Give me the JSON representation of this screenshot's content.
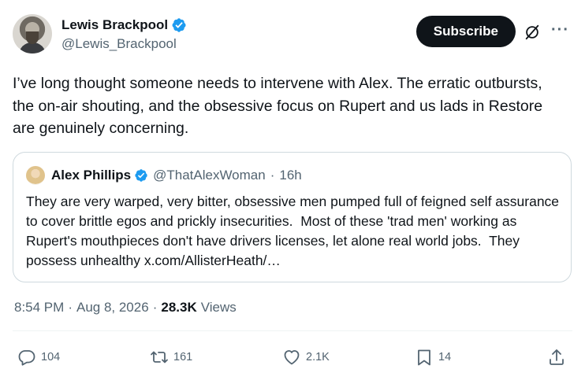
{
  "author": {
    "display_name": "Lewis Brackpool",
    "handle": "@Lewis_Brackpool"
  },
  "header": {
    "subscribe_label": "Subscribe",
    "more_label": "···"
  },
  "tweet": {
    "text": "I’ve long thought someone needs to intervene with Alex. The erratic outbursts, the on-air shouting, and the obsessive focus on Rupert and us lads in Restore are genuinely concerning."
  },
  "quote": {
    "display_name": "Alex Phillips",
    "handle": "@ThatAlexWoman",
    "separator": "·",
    "age": "16h",
    "text": "They are very warped, very bitter, obsessive men pumped full of feigned self assurance to cover brittle egos and prickly insecurities.  Most of these 'trad men' working as Rupert's mouthpieces don't have drivers licenses, let alone real world jobs.  They possess unhealthy x.com/AllisterHeath/…"
  },
  "meta": {
    "time": "8:54 PM",
    "sep1": "·",
    "date": "Aug 8, 2026",
    "sep2": "·",
    "views_count": "28.3K",
    "views_label": "Views"
  },
  "actions": {
    "replies": "104",
    "reposts": "161",
    "likes": "2.1K",
    "bookmarks": "14"
  },
  "colors": {
    "verified": "#1d9bf0",
    "text_primary": "#0f1419",
    "text_secondary": "#536471",
    "border": "#cfd9de"
  }
}
